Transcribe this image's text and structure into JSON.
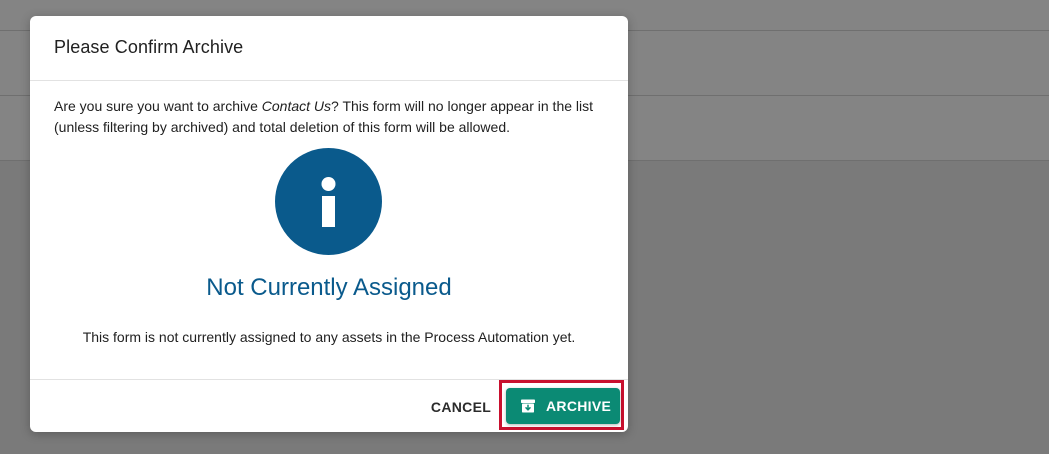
{
  "dialog": {
    "title": "Please Confirm Archive",
    "message_prefix": "Are you sure you want to archive ",
    "form_name": "Contact Us",
    "message_suffix": "? This form will no longer appear in the list (unless filtering by archived) and total deletion of this form will be allowed.",
    "info_icon": "info-icon",
    "assignment_heading": "Not Currently Assigned",
    "assignment_text": "This form is not currently assigned to any assets in the Process Automation yet.",
    "cancel_label": "CANCEL",
    "archive_label": "ARCHIVE",
    "archive_icon": "archive-box-icon"
  },
  "colors": {
    "accent_blue": "#0a5a8c",
    "archive_green": "#0b8a74",
    "highlight_red": "#c8102e",
    "overlay_gray": "#7a7a7a"
  }
}
